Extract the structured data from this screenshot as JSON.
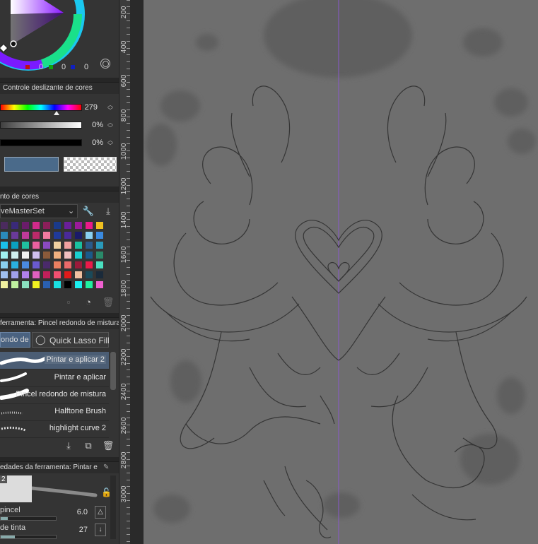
{
  "color_wheel": {
    "r": "0",
    "g": "0",
    "b": "0"
  },
  "color_slider": {
    "title": "Controle deslizante de cores",
    "hue_value": "279",
    "sat_value": "0%",
    "val_value": "0%",
    "colors": {
      "current": "#4a6a8a"
    }
  },
  "color_set": {
    "title": "nto de cores",
    "selected_set": "veMasterSet",
    "swatches": [
      [
        "#4b2b5e",
        "#3a2a7a",
        "#6a1c6a",
        "#d02a8a",
        "#8a1f5a",
        "#1a3a8a",
        "#6a1f9a",
        "#9a1a9a",
        "#ea1a8a",
        "#f0c020"
      ],
      [
        "#2a8aba",
        "#6a3a9a",
        "#c03a9a",
        "#ba2a6a",
        "#f07aa0",
        "#203a9a",
        "#4a2a9a",
        "#1a1a6a",
        "#8ad0f0",
        "#3a8ae0"
      ],
      [
        "#1ac0ea",
        "#0aa0c0",
        "#20c0a0",
        "#ea60a0",
        "#8a4ac0",
        "#f0d0a0",
        "#f0a0a0",
        "#1ac0a0",
        "#2a5a8a",
        "#2a9aba"
      ],
      [
        "#a0f0f0",
        "#d0f0f0",
        "#f0f0f0",
        "#d0c0f0",
        "#8a5a3a",
        "#f0b080",
        "#f0c0c0",
        "#1ad0d0",
        "#1a5a8a",
        "#2a8a6a"
      ],
      [
        "#8ad0f0",
        "#2ab0e0",
        "#4a8ae0",
        "#6a5ad0",
        "#4a2a6a",
        "#ea8060",
        "#ea6a6a",
        "#9a1a3a",
        "#ea1a4a",
        "#4ae0c0"
      ],
      [
        "#a0c0f0",
        "#a0a0ea",
        "#b080ea",
        "#e060c0",
        "#c0205a",
        "#f05070",
        "#e01a1a",
        "#f0c0a0",
        "#1a4a5a",
        "#1a2a3a"
      ],
      [
        "#f0f0a0",
        "#c0f0a0",
        "#8ae0c0",
        "#f0f020",
        "#2a60b0",
        "#1ae0e0",
        "#000000",
        "#1af0f0",
        "#20f0a0",
        "#f060d0"
      ]
    ]
  },
  "tool": {
    "title": "ferramenta: Pincel redondo de mistura",
    "tab_left": "ondo de m",
    "tab_right": "Quick Lasso Fill"
  },
  "brushes": [
    {
      "label": "Pintar e aplicar 2"
    },
    {
      "label": "Pintar e aplicar"
    },
    {
      "label": "Pincel redondo de mistura"
    },
    {
      "label": "Halftone Brush"
    },
    {
      "label": "highlight curve 2"
    }
  ],
  "tool_props": {
    "title": "edades da ferramenta: Pintar e",
    "badge": "2",
    "size_label": "pincel",
    "size_value": "6.0",
    "ink_label": "de tinta",
    "ink_value": "27"
  },
  "ruler": {
    "labels": [
      "200",
      "400",
      "600",
      "800",
      "1000",
      "1200",
      "1400",
      "1600",
      "1800",
      "2000",
      "2200",
      "2400",
      "2600",
      "2800",
      "3000"
    ]
  }
}
